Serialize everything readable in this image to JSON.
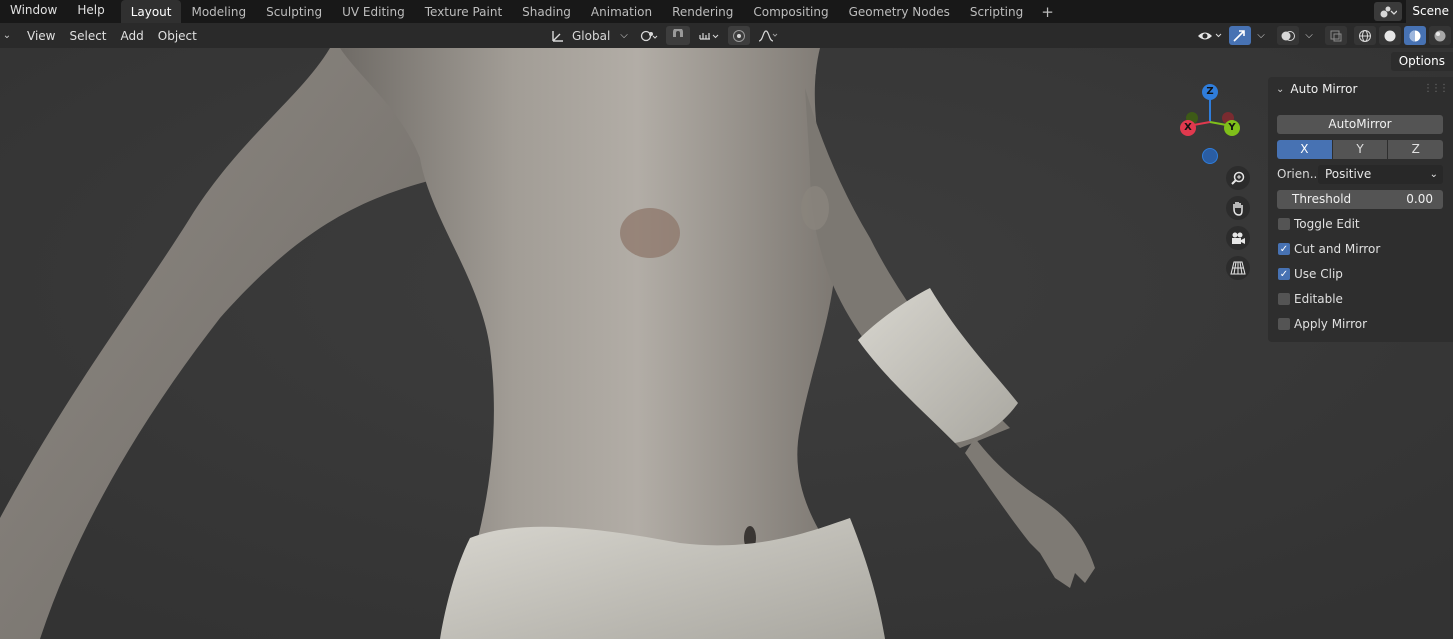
{
  "topbar": {
    "menus": [
      "Window",
      "Help"
    ],
    "tabs": [
      "Layout",
      "Modeling",
      "Sculpting",
      "UV Editing",
      "Texture Paint",
      "Shading",
      "Animation",
      "Rendering",
      "Compositing",
      "Geometry Nodes",
      "Scripting"
    ],
    "active_tab": "Layout",
    "add_tab": "+",
    "scene_label": "Scene"
  },
  "header": {
    "menus": [
      "View",
      "Select",
      "Add",
      "Object"
    ],
    "transform_orientation": "Global"
  },
  "viewport": {
    "options_label": "Options",
    "gizmo": {
      "z": "Z",
      "x": "X",
      "y": "Y"
    }
  },
  "auto_mirror": {
    "title": "Auto Mirror",
    "button": "AutoMirror",
    "axes": [
      "X",
      "Y",
      "Z"
    ],
    "selected_axis": "X",
    "orientation_label": "Orien...",
    "orientation_value": "Positive",
    "threshold_label": "Threshold",
    "threshold_value": "0.00",
    "options": [
      {
        "label": "Toggle Edit",
        "checked": false
      },
      {
        "label": "Cut and Mirror",
        "checked": true
      },
      {
        "label": "Use Clip",
        "checked": true
      },
      {
        "label": "Editable",
        "checked": false
      },
      {
        "label": "Apply Mirror",
        "checked": false
      }
    ]
  },
  "colors": {
    "accent": "#4772b3",
    "gizmo_x": "#e0394e",
    "gizmo_y": "#7fbf1a",
    "gizmo_z": "#2f7ddb"
  }
}
